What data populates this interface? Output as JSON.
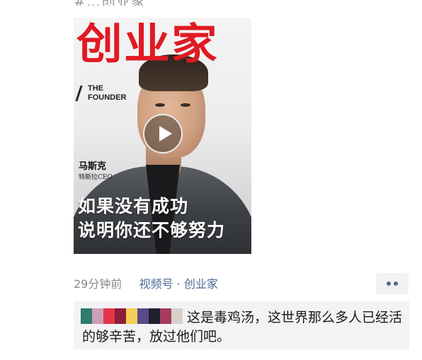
{
  "header": {
    "cut_title": "#…创业家"
  },
  "video": {
    "brand": "创业家",
    "brand_sub": [
      "THE",
      "FOUNDER"
    ],
    "person_name": "马斯克",
    "person_title": "特斯拉CEO",
    "headline_line1": "如果没有成功",
    "headline_line2": "说明你还不够努力"
  },
  "meta": {
    "time": "29分钟前",
    "channel_type": "视频号",
    "separator": "·",
    "source": "创业家"
  },
  "colors": {
    "brand_red": "#e01a22",
    "link_blue": "#4e6a93",
    "comment_bg": "#f3f3f5"
  },
  "comment": {
    "censor_colors": [
      "#2f7b6e",
      "#caa0b4",
      "#e7334a",
      "#8b1e3a",
      "#f3cf56",
      "#5a4a8a",
      "#1f1f2e",
      "#a33c5e",
      "#d8d0c8"
    ],
    "text": "这是毒鸡汤，这世界那么多人已经活的够辛苦，放过他们吧。"
  }
}
